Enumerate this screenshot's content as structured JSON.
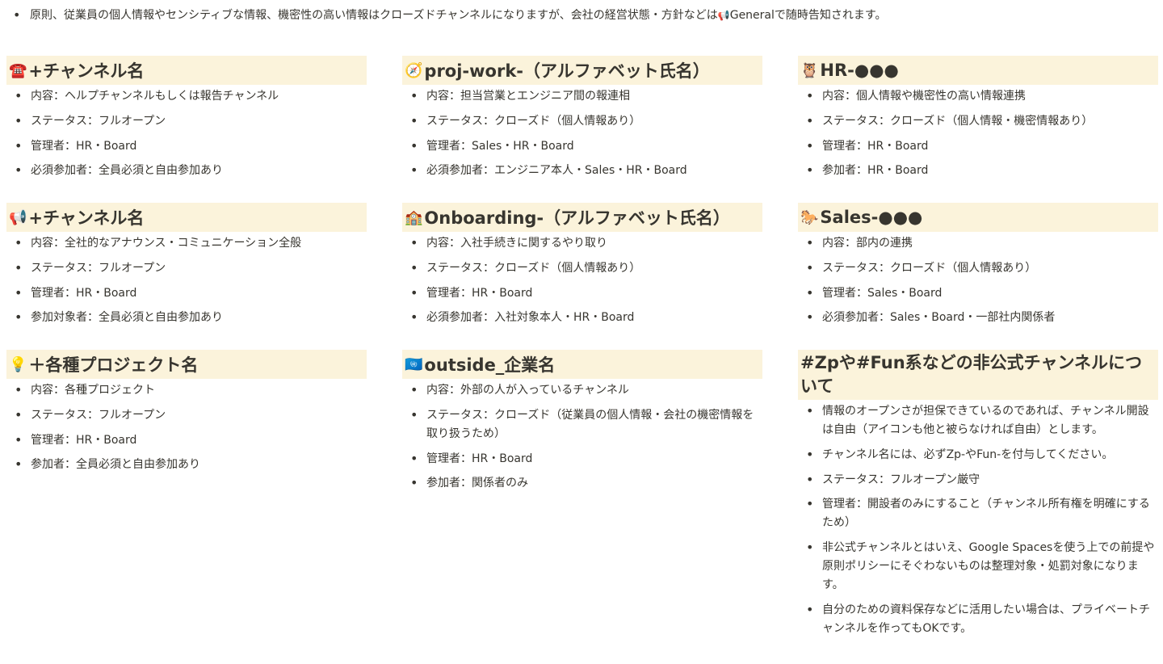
{
  "intro": {
    "text_before": "原則、従業員の個人情報やセンシティブな情報、機密性の高い情報はクローズドチャンネルになりますが、会社の経営状態・方針などは",
    "icon": "📢",
    "text_after": "Generalで随時告知されます。"
  },
  "sections": [
    {
      "icon": "☎️",
      "title": "+チャンネル名",
      "items": [
        "内容：ヘルプチャンネルもしくは報告チャンネル",
        "ステータス：フルオープン",
        "管理者：HR・Board",
        "必須参加者：全員必須と自由参加あり"
      ]
    },
    {
      "icon": "🧭",
      "title": "proj-work-（アルファベット氏名）",
      "items": [
        "内容：担当営業とエンジニア間の報連相",
        "ステータス：クローズド（個人情報あり）",
        "管理者：Sales・HR・Board",
        "必須参加者：エンジニア本人・Sales・HR・Board"
      ]
    },
    {
      "icon": "🦉",
      "title": "HR-●●●",
      "items": [
        "内容：個人情報や機密性の高い情報連携",
        "ステータス：クローズド（個人情報・機密情報あり）",
        "管理者：HR・Board",
        "参加者：HR・Board"
      ]
    },
    {
      "icon": "📢",
      "title": "+チャンネル名",
      "items": [
        "内容：全社的なアナウンス・コミュニケーション全般",
        "ステータス：フルオープン",
        "管理者：HR・Board",
        "参加対象者：全員必須と自由参加あり"
      ]
    },
    {
      "icon": "🏫",
      "title": "Onboarding-（アルファベット氏名）",
      "items": [
        "内容：入社手続きに関するやり取り",
        "ステータス：クローズド（個人情報あり）",
        "管理者：HR・Board",
        "必須参加者：入社対象本人・HR・Board"
      ]
    },
    {
      "icon": "🐎",
      "title": "Sales-●●●",
      "items": [
        "内容：部内の連携",
        "ステータス：クローズド（個人情報あり）",
        "管理者：Sales・Board",
        "必須参加者：Sales・Board・一部社内関係者"
      ]
    },
    {
      "icon": "💡",
      "title": "＋各種プロジェクト名",
      "items": [
        "内容：各種プロジェクト",
        "ステータス：フルオープン",
        "管理者：HR・Board",
        "参加者：全員必須と自由参加あり"
      ]
    },
    {
      "icon": "🇺🇳",
      "title": "outside_企業名",
      "items": [
        "内容：外部の人が入っているチャンネル",
        "ステータス：クローズド（従業員の個人情報・会社の機密情報を取り扱うため）",
        "管理者：HR・Board",
        "参加者：関係者のみ"
      ]
    },
    {
      "icon": "",
      "title": "#Zpや#Fun系などの非公式チャンネルについて",
      "items": [
        "情報のオープンさが担保できているのであれば、チャンネル開設は自由（アイコンも他と被らなければ自由）とします。",
        "チャンネル名には、必ずZp-やFun-を付与してください。",
        "ステータス：フルオープン厳守",
        "管理者：開設者のみにすること（チャンネル所有権を明確にするため）",
        "非公式チャンネルとはいえ、Google Spacesを使う上での前提や原則ポリシーにそぐわないものは整理対象・処罰対象になります。",
        "自分のための資料保存などに活用したい場合は、プライベートチャンネルを作ってもOKです。"
      ]
    }
  ]
}
